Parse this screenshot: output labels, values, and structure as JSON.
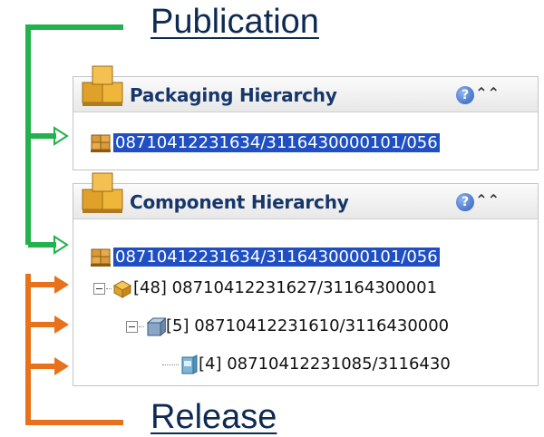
{
  "annotations": {
    "publication_label": "Publication",
    "release_label": "Release",
    "colors": {
      "publication": "#22b14c",
      "release": "#e8711c"
    }
  },
  "packaging_panel": {
    "title": "Packaging Hierarchy",
    "help_glyph": "?",
    "collapse_glyph": "⌃⌃",
    "rows": [
      {
        "text": "08710412231634/3116430000101/056",
        "selected": true,
        "icon": "pallet-icon"
      }
    ]
  },
  "component_panel": {
    "title": "Component Hierarchy",
    "help_glyph": "?",
    "collapse_glyph": "⌃⌃",
    "rows": [
      {
        "text": "08710412231634/3116430000101/056",
        "selected": true,
        "icon": "pallet-icon"
      },
      {
        "text": "[48] 08710412231627/31164300001",
        "selected": false,
        "icon": "case-icon"
      },
      {
        "text": "[5] 08710412231610/3116430000",
        "selected": false,
        "icon": "pack-icon"
      },
      {
        "text": "[4] 08710412231085/3116430",
        "selected": false,
        "icon": "unit-icon"
      }
    ]
  }
}
